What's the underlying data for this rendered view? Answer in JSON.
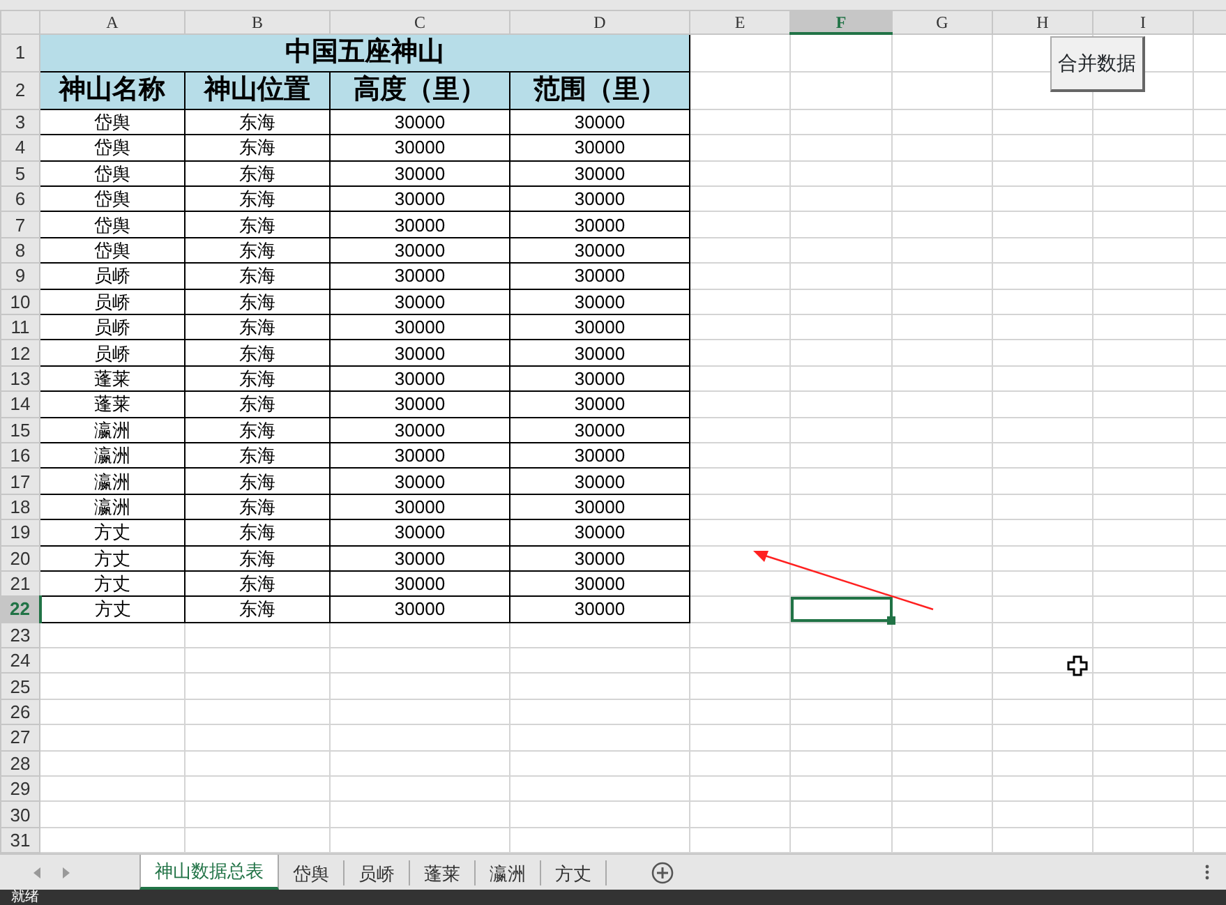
{
  "columns": [
    {
      "label": "A",
      "selected": false
    },
    {
      "label": "B",
      "selected": false
    },
    {
      "label": "C",
      "selected": false
    },
    {
      "label": "D",
      "selected": false
    },
    {
      "label": "E",
      "selected": false
    },
    {
      "label": "F",
      "selected": true
    },
    {
      "label": "G",
      "selected": false
    },
    {
      "label": "H",
      "selected": false
    },
    {
      "label": "I",
      "selected": false
    }
  ],
  "row_numbers": [
    {
      "label": "1",
      "selected": false
    },
    {
      "label": "2",
      "selected": false
    },
    {
      "label": "3",
      "selected": false
    },
    {
      "label": "4",
      "selected": false
    },
    {
      "label": "5",
      "selected": false
    },
    {
      "label": "6",
      "selected": false
    },
    {
      "label": "7",
      "selected": false
    },
    {
      "label": "8",
      "selected": false
    },
    {
      "label": "9",
      "selected": false
    },
    {
      "label": "10",
      "selected": false
    },
    {
      "label": "11",
      "selected": false
    },
    {
      "label": "12",
      "selected": false
    },
    {
      "label": "13",
      "selected": false
    },
    {
      "label": "14",
      "selected": false
    },
    {
      "label": "15",
      "selected": false
    },
    {
      "label": "16",
      "selected": false
    },
    {
      "label": "17",
      "selected": false
    },
    {
      "label": "18",
      "selected": false
    },
    {
      "label": "19",
      "selected": false
    },
    {
      "label": "20",
      "selected": false
    },
    {
      "label": "21",
      "selected": false
    },
    {
      "label": "22",
      "selected": true
    },
    {
      "label": "23",
      "selected": false
    },
    {
      "label": "24",
      "selected": false
    },
    {
      "label": "25",
      "selected": false
    },
    {
      "label": "26",
      "selected": false
    },
    {
      "label": "27",
      "selected": false
    },
    {
      "label": "28",
      "selected": false
    },
    {
      "label": "29",
      "selected": false
    },
    {
      "label": "30",
      "selected": false
    },
    {
      "label": "31",
      "selected": false
    }
  ],
  "title": "中国五座神山",
  "headers": [
    "神山名称",
    "神山位置",
    "高度（里）",
    "范围（里）"
  ],
  "data_rows": [
    [
      "岱舆",
      "东海",
      "30000",
      "30000"
    ],
    [
      "岱舆",
      "东海",
      "30000",
      "30000"
    ],
    [
      "岱舆",
      "东海",
      "30000",
      "30000"
    ],
    [
      "岱舆",
      "东海",
      "30000",
      "30000"
    ],
    [
      "岱舆",
      "东海",
      "30000",
      "30000"
    ],
    [
      "岱舆",
      "东海",
      "30000",
      "30000"
    ],
    [
      "员峤",
      "东海",
      "30000",
      "30000"
    ],
    [
      "员峤",
      "东海",
      "30000",
      "30000"
    ],
    [
      "员峤",
      "东海",
      "30000",
      "30000"
    ],
    [
      "员峤",
      "东海",
      "30000",
      "30000"
    ],
    [
      "蓬莱",
      "东海",
      "30000",
      "30000"
    ],
    [
      "蓬莱",
      "东海",
      "30000",
      "30000"
    ],
    [
      "瀛洲",
      "东海",
      "30000",
      "30000"
    ],
    [
      "瀛洲",
      "东海",
      "30000",
      "30000"
    ],
    [
      "瀛洲",
      "东海",
      "30000",
      "30000"
    ],
    [
      "瀛洲",
      "东海",
      "30000",
      "30000"
    ],
    [
      "方丈",
      "东海",
      "30000",
      "30000"
    ],
    [
      "方丈",
      "东海",
      "30000",
      "30000"
    ],
    [
      "方丈",
      "东海",
      "30000",
      "30000"
    ],
    [
      "方丈",
      "东海",
      "30000",
      "30000"
    ]
  ],
  "button": {
    "label": "合并数据"
  },
  "sheet_tabs": [
    {
      "label": "神山数据总表",
      "selected": true
    },
    {
      "label": "岱舆",
      "selected": false
    },
    {
      "label": "员峤",
      "selected": false
    },
    {
      "label": "蓬莱",
      "selected": false
    },
    {
      "label": "瀛洲",
      "selected": false
    },
    {
      "label": "方丈",
      "selected": false
    }
  ],
  "status_bar": {
    "text": "就绪"
  }
}
